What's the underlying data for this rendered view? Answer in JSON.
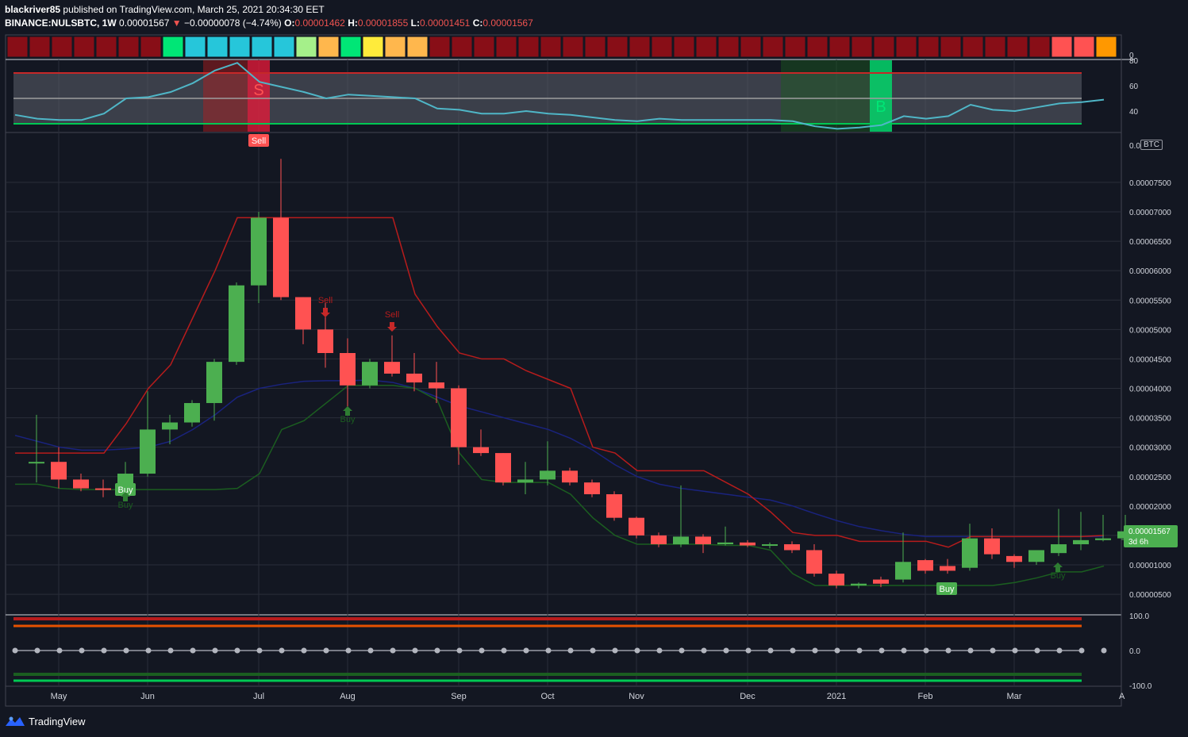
{
  "header": {
    "author": "blackriver85",
    "published": "published on TradingView.com, March 25, 2021 20:34:30 EET",
    "symbol": "BINANCE:NULSBTC, 1W",
    "last": "0.00001567",
    "change": "−0.00000078 (−4.74%)",
    "o_label": "O:",
    "o": "0.00001462",
    "h_label": "H:",
    "h": "0.00001855",
    "l_label": "L:",
    "l": "0.00001451",
    "c_label": "C:",
    "c": "0.00001567"
  },
  "footer": {
    "brand": "TradingView"
  },
  "price_tag": {
    "price": "0.00001567",
    "countdown": "3d 6h"
  },
  "btc_label": "BTC",
  "colors": {
    "up": "#4caf50",
    "down": "#ff5252",
    "bg": "#131722",
    "grid": "#2a2e39",
    "red_line": "#b71c1c",
    "green_line": "#1b5e20",
    "blue_line": "#1a237e",
    "osc": "#4fb6c7"
  },
  "heat_strip": [
    "#880e17",
    "#880e17",
    "#880e17",
    "#880e17",
    "#880e17",
    "#880e17",
    "#880e17",
    "#00e676",
    "#26c6da",
    "#26c6da",
    "#26c6da",
    "#26c6da",
    "#26c6da",
    "#a5f08a",
    "#ffb74d",
    "#00e676",
    "#ffeb3b",
    "#ffb74d",
    "#ffb74d",
    "#880e17",
    "#880e17",
    "#880e17",
    "#880e17",
    "#880e17",
    "#880e17",
    "#880e17",
    "#880e17",
    "#880e17",
    "#880e17",
    "#880e17",
    "#880e17",
    "#880e17",
    "#880e17",
    "#880e17",
    "#880e17",
    "#880e17",
    "#880e17",
    "#880e17",
    "#880e17",
    "#880e17",
    "#880e17",
    "#880e17",
    "#880e17",
    "#880e17",
    "#880e17",
    "#880e17",
    "#880e17",
    "#ff5252",
    "#ff5252",
    "#ff9800"
  ],
  "chart_data": {
    "type": "candlestick",
    "x_ticks": [
      "May",
      "Jun",
      "Jul",
      "Aug",
      "Sep",
      "Oct",
      "Nov",
      "Dec",
      "2021",
      "Feb",
      "Mar"
    ],
    "y_ticks": [
      "0.00007500",
      "0.00007000",
      "0.00006500",
      "0.00006000",
      "0.00005500",
      "0.00005000",
      "0.00004500",
      "0.00004000",
      "0.00003500",
      "0.00003000",
      "0.00002500",
      "0.00002000",
      "0.00001500",
      "0.00001000",
      "0.00000500"
    ],
    "y_top_tick": "0.0",
    "ylim": [
      1.8e-06,
      8e-06
    ],
    "candles": [
      {
        "o": 2.75e-05,
        "h": 3.55e-05,
        "l": 2.4e-05,
        "c": 2.75e-05
      },
      {
        "o": 2.75e-05,
        "h": 3e-05,
        "l": 2.3e-05,
        "c": 2.45e-05
      },
      {
        "o": 2.45e-05,
        "h": 2.55e-05,
        "l": 2.25e-05,
        "c": 2.3e-05
      },
      {
        "o": 2.3e-05,
        "h": 2.45e-05,
        "l": 2.15e-05,
        "c": 2.28e-05
      },
      {
        "o": 2.28e-05,
        "h": 2.75e-05,
        "l": 2.25e-05,
        "c": 2.55e-05
      },
      {
        "o": 2.55e-05,
        "h": 3.95e-05,
        "l": 2.5e-05,
        "c": 3.3e-05
      },
      {
        "o": 3.3e-05,
        "h": 3.55e-05,
        "l": 3.05e-05,
        "c": 3.42e-05
      },
      {
        "o": 3.42e-05,
        "h": 3.8e-05,
        "l": 3.35e-05,
        "c": 3.75e-05
      },
      {
        "o": 3.75e-05,
        "h": 4.5e-05,
        "l": 3.45e-05,
        "c": 4.45e-05
      },
      {
        "o": 4.45e-05,
        "h": 5.8e-05,
        "l": 4.4e-05,
        "c": 5.75e-05
      },
      {
        "o": 5.75e-05,
        "h": 7e-05,
        "l": 5.45e-05,
        "c": 6.9e-05
      },
      {
        "o": 6.9e-05,
        "h": 7.9e-05,
        "l": 5.5e-05,
        "c": 5.55e-05
      },
      {
        "o": 5.55e-05,
        "h": 5.55e-05,
        "l": 4.75e-05,
        "c": 5e-05
      },
      {
        "o": 5e-05,
        "h": 5.45e-05,
        "l": 4.35e-05,
        "c": 4.6e-05
      },
      {
        "o": 4.6e-05,
        "h": 4.85e-05,
        "l": 3.65e-05,
        "c": 4.05e-05
      },
      {
        "o": 4.05e-05,
        "h": 4.5e-05,
        "l": 4e-05,
        "c": 4.45e-05
      },
      {
        "o": 4.45e-05,
        "h": 4.9e-05,
        "l": 4.2e-05,
        "c": 4.25e-05
      },
      {
        "o": 4.25e-05,
        "h": 4.6e-05,
        "l": 3.95e-05,
        "c": 4.1e-05
      },
      {
        "o": 4.1e-05,
        "h": 4.45e-05,
        "l": 3.75e-05,
        "c": 4e-05
      },
      {
        "o": 4e-05,
        "h": 4.05e-05,
        "l": 2.7e-05,
        "c": 3e-05
      },
      {
        "o": 3e-05,
        "h": 3.3e-05,
        "l": 2.85e-05,
        "c": 2.9e-05
      },
      {
        "o": 2.9e-05,
        "h": 2.9e-05,
        "l": 2.35e-05,
        "c": 2.4e-05
      },
      {
        "o": 2.4e-05,
        "h": 2.75e-05,
        "l": 2.2e-05,
        "c": 2.45e-05
      },
      {
        "o": 2.45e-05,
        "h": 3.1e-05,
        "l": 2.35e-05,
        "c": 2.6e-05
      },
      {
        "o": 2.6e-05,
        "h": 2.65e-05,
        "l": 2.35e-05,
        "c": 2.4e-05
      },
      {
        "o": 2.4e-05,
        "h": 2.45e-05,
        "l": 2.15e-05,
        "c": 2.2e-05
      },
      {
        "o": 2.2e-05,
        "h": 2.25e-05,
        "l": 1.75e-05,
        "c": 1.8e-05
      },
      {
        "o": 1.8e-05,
        "h": 1.82e-05,
        "l": 1.45e-05,
        "c": 1.5e-05
      },
      {
        "o": 1.5e-05,
        "h": 1.55e-05,
        "l": 1.3e-05,
        "c": 1.35e-05
      },
      {
        "o": 1.35e-05,
        "h": 2.35e-05,
        "l": 1.3e-05,
        "c": 1.48e-05
      },
      {
        "o": 1.48e-05,
        "h": 1.52e-05,
        "l": 1.2e-05,
        "c": 1.35e-05
      },
      {
        "o": 1.35e-05,
        "h": 1.65e-05,
        "l": 1.33e-05,
        "c": 1.38e-05
      },
      {
        "o": 1.38e-05,
        "h": 1.42e-05,
        "l": 1.3e-05,
        "c": 1.33e-05
      },
      {
        "o": 1.33e-05,
        "h": 1.38e-05,
        "l": 1.28e-05,
        "c": 1.35e-05
      },
      {
        "o": 1.35e-05,
        "h": 1.4e-05,
        "l": 1.2e-05,
        "c": 1.25e-05
      },
      {
        "o": 1.25e-05,
        "h": 1.35e-05,
        "l": 8e-06,
        "c": 8.5e-06
      },
      {
        "o": 8.5e-06,
        "h": 9e-06,
        "l": 6e-06,
        "c": 6.5e-06
      },
      {
        "o": 6.5e-06,
        "h": 7e-06,
        "l": 6e-06,
        "c": 6.8e-06
      },
      {
        "o": 7.5e-06,
        "h": 8e-06,
        "l": 6.2e-06,
        "c": 6.8e-06
      },
      {
        "o": 7.5e-06,
        "h": 1.55e-05,
        "l": 7e-06,
        "c": 1.05e-05
      },
      {
        "o": 1.08e-05,
        "h": 1.1e-05,
        "l": 8.5e-06,
        "c": 9e-06
      },
      {
        "o": 9.8e-06,
        "h": 1.1e-05,
        "l": 8.5e-06,
        "c": 9e-06
      },
      {
        "o": 9.5e-06,
        "h": 1.7e-05,
        "l": 9e-06,
        "c": 1.45e-05
      },
      {
        "o": 1.45e-05,
        "h": 1.62e-05,
        "l": 1.1e-05,
        "c": 1.18e-05
      },
      {
        "o": 1.15e-05,
        "h": 1.18e-05,
        "l": 9.5e-06,
        "c": 1.05e-05
      },
      {
        "o": 1.05e-05,
        "h": 1.25e-05,
        "l": 1e-05,
        "c": 1.25e-05
      },
      {
        "o": 1.2e-05,
        "h": 1.95e-05,
        "l": 1.15e-05,
        "c": 1.35e-05
      },
      {
        "o": 1.35e-05,
        "h": 1.9e-05,
        "l": 1.25e-05,
        "c": 1.42e-05
      },
      {
        "o": 1.42e-05,
        "h": 1.85e-05,
        "l": 1.4e-05,
        "c": 1.45e-05
      },
      {
        "o": 1.45e-05,
        "h": 1.85e-05,
        "l": 1.4e-05,
        "c": 1.57e-05
      }
    ],
    "red_line": [
      2.9e-05,
      2.9e-05,
      2.9e-05,
      2.9e-05,
      2.9e-05,
      3.4e-05,
      4e-05,
      4.4e-05,
      5.2e-05,
      6e-05,
      6.9e-05,
      6.9e-05,
      6.9e-05,
      6.9e-05,
      6.9e-05,
      6.9e-05,
      6.9e-05,
      6.9e-05,
      5.6e-05,
      5.05e-05,
      4.6e-05,
      4.5e-05,
      4.5e-05,
      4.3e-05,
      4.15e-05,
      4e-05,
      3e-05,
      2.9e-05,
      2.6e-05,
      2.6e-05,
      2.6e-05,
      2.6e-05,
      2.4e-05,
      2.2e-05,
      1.9e-05,
      1.55e-05,
      1.5e-05,
      1.5e-05,
      1.4e-05,
      1.4e-05,
      1.4e-05,
      1.4e-05,
      1.3e-05,
      1.48e-05,
      1.48e-05,
      1.48e-05,
      1.48e-05,
      1.48e-05,
      1.48e-05,
      1.5e-05
    ],
    "green_line": [
      2.37e-05,
      2.37e-05,
      2.3e-05,
      2.28e-05,
      2.28e-05,
      2.28e-05,
      2.28e-05,
      2.28e-05,
      2.28e-05,
      2.28e-05,
      2.3e-05,
      2.55e-05,
      3.3e-05,
      3.45e-05,
      3.75e-05,
      4.05e-05,
      4.05e-05,
      4.05e-05,
      4e-05,
      3.8e-05,
      2.9e-05,
      2.45e-05,
      2.4e-05,
      2.4e-05,
      2.4e-05,
      2.2e-05,
      1.8e-05,
      1.5e-05,
      1.35e-05,
      1.35e-05,
      1.35e-05,
      1.35e-05,
      1.33e-05,
      1.33e-05,
      1.25e-05,
      8.5e-06,
      6.5e-06,
      6.5e-06,
      6.5e-06,
      6.5e-06,
      6.5e-06,
      6.5e-06,
      6.5e-06,
      6.5e-06,
      6.5e-06,
      7e-06,
      7.8e-06,
      8.8e-06,
      8.8e-06,
      9.8e-06
    ],
    "blue_line": [
      3.2e-05,
      3.1e-05,
      3e-05,
      2.95e-05,
      2.95e-05,
      2.97e-05,
      3e-05,
      3.1e-05,
      3.3e-05,
      3.55e-05,
      3.85e-05,
      4e-05,
      4.07e-05,
      4.12e-05,
      4.13e-05,
      4.13e-05,
      4.14e-05,
      4.1e-05,
      4e-05,
      3.85e-05,
      3.7e-05,
      3.6e-05,
      3.5e-05,
      3.4e-05,
      3.3e-05,
      3.15e-05,
      2.95e-05,
      2.7e-05,
      2.5e-05,
      2.37e-05,
      2.3e-05,
      2.25e-05,
      2.2e-05,
      2.15e-05,
      2.1e-05,
      2e-05,
      1.87e-05,
      1.75e-05,
      1.65e-05,
      1.58e-05,
      1.52e-05,
      1.48e-05,
      1.48e-05,
      1.48e-05,
      1.48e-05,
      1.48e-05,
      1.48e-05,
      1.48e-05,
      1.48e-05,
      1.48e-05
    ],
    "signals": [
      {
        "i": 4,
        "label": "Buy",
        "kind": "buy-box"
      },
      {
        "i": 4,
        "label": "Buy",
        "kind": "buy-text"
      },
      {
        "i": 11,
        "label": "Sell",
        "kind": "sell-box"
      },
      {
        "i": 14,
        "label": "Sell",
        "kind": "sell-text"
      },
      {
        "i": 15,
        "label": "Buy",
        "kind": "buy-text"
      },
      {
        "i": 17,
        "label": "Sell",
        "kind": "sell-text"
      },
      {
        "i": 42,
        "label": "Buy",
        "kind": "buy-box"
      },
      {
        "i": 47,
        "label": "Buy",
        "kind": "buy-text"
      }
    ]
  },
  "oscillator": {
    "ticks": [
      "80",
      "60",
      "40"
    ],
    "zero_label": "0",
    "upper": 70,
    "lower": 30,
    "mid": 50,
    "values": [
      37,
      34,
      33,
      33,
      38,
      50,
      51,
      55,
      62,
      72,
      78,
      63,
      59,
      55,
      50,
      53,
      52,
      51,
      50,
      42,
      41,
      38,
      38,
      40,
      38,
      37,
      35,
      33,
      32,
      34,
      33,
      33,
      33,
      33,
      33,
      32,
      28,
      26,
      27,
      29,
      36,
      34,
      36,
      45,
      41,
      40,
      43,
      46,
      47,
      49
    ],
    "sell_letter": "S",
    "buy_letter": "B"
  },
  "bottom_panel": {
    "ticks": [
      "100.0",
      "0.0",
      "-100.0"
    ]
  },
  "last_x_tick": "A"
}
